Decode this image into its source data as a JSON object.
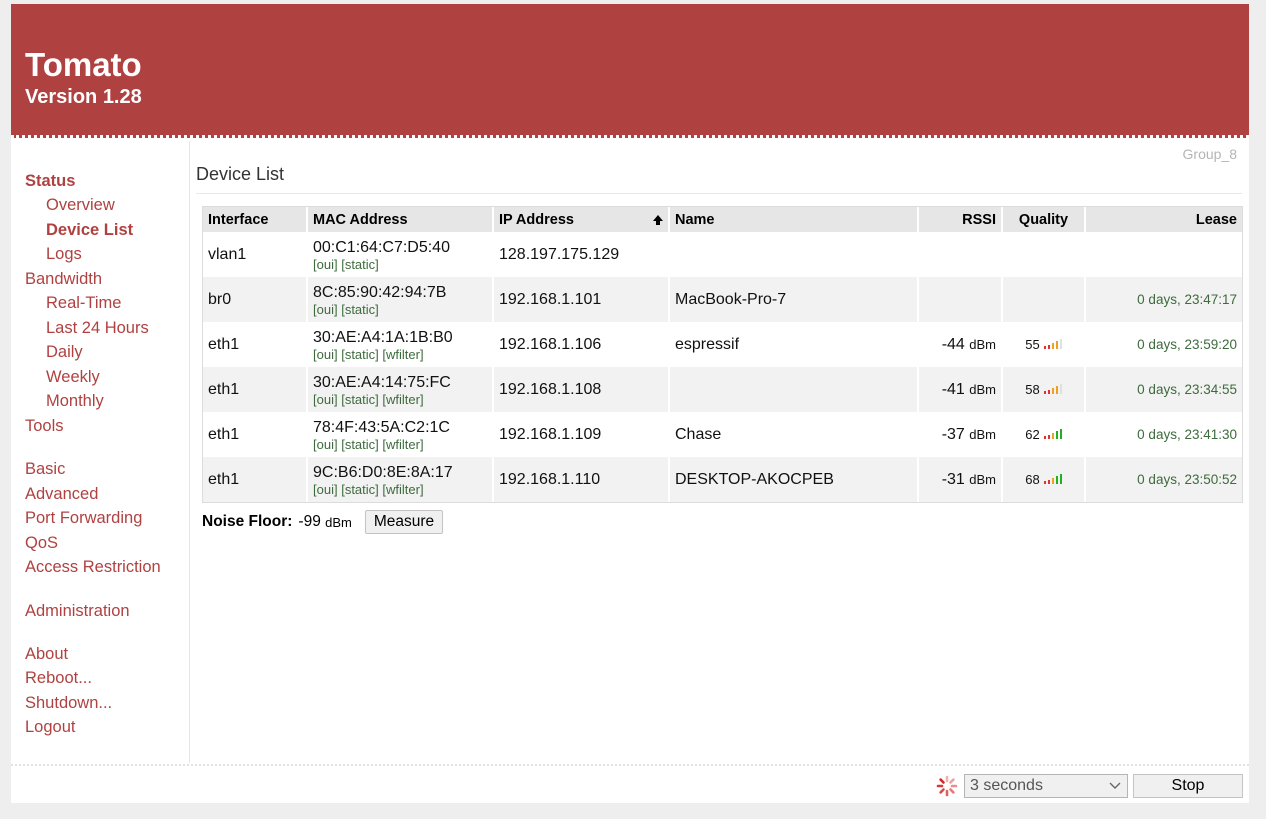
{
  "header": {
    "title": "Tomato",
    "version": "Version 1.28"
  },
  "group_label": "Group_8",
  "sidebar": [
    {
      "label": "Status",
      "type": "section-active"
    },
    {
      "label": "Overview",
      "type": "sub"
    },
    {
      "label": "Device List",
      "type": "sub-active"
    },
    {
      "label": "Logs",
      "type": "sub"
    },
    {
      "label": "Bandwidth",
      "type": "section"
    },
    {
      "label": "Real-Time",
      "type": "sub"
    },
    {
      "label": "Last 24 Hours",
      "type": "sub"
    },
    {
      "label": "Daily",
      "type": "sub"
    },
    {
      "label": "Weekly",
      "type": "sub"
    },
    {
      "label": "Monthly",
      "type": "sub"
    },
    {
      "label": "Tools",
      "type": "section"
    },
    {
      "label": "Basic",
      "type": "section"
    },
    {
      "label": "Advanced",
      "type": "section"
    },
    {
      "label": "Port Forwarding",
      "type": "section"
    },
    {
      "label": "QoS",
      "type": "section"
    },
    {
      "label": "Access Restriction",
      "type": "section"
    },
    {
      "label": "Administration",
      "type": "section"
    },
    {
      "label": "About",
      "type": "section"
    },
    {
      "label": "Reboot...",
      "type": "section"
    },
    {
      "label": "Shutdown...",
      "type": "section"
    },
    {
      "label": "Logout",
      "type": "section"
    }
  ],
  "page_title": "Device List",
  "table": {
    "headers": [
      "Interface",
      "MAC Address",
      "IP Address",
      "Name",
      "RSSI",
      "Quality",
      "Lease"
    ],
    "link_labels": {
      "oui": "[oui]",
      "static": "[static]",
      "wfilter": "[wfilter]"
    },
    "rssi_unit": "dBm",
    "rows": [
      {
        "interface": "vlan1",
        "mac": "00:C1:64:C7:D5:40",
        "links": [
          "oui",
          "static"
        ],
        "ip": "128.197.175.129",
        "name": "",
        "rssi": "",
        "quality": "",
        "bars": 0,
        "lease": ""
      },
      {
        "interface": "br0",
        "mac": "8C:85:90:42:94:7B",
        "links": [
          "oui",
          "static"
        ],
        "ip": "192.168.1.101",
        "name": "MacBook-Pro-7",
        "rssi": "",
        "quality": "",
        "bars": 0,
        "lease": "0 days, 23:47:17"
      },
      {
        "interface": "eth1",
        "mac": "30:AE:A4:1A:1B:B0",
        "links": [
          "oui",
          "static",
          "wfilter"
        ],
        "ip": "192.168.1.106",
        "name": "espressif",
        "rssi": "-44",
        "quality": "55",
        "bars": 4,
        "lease": "0 days, 23:59:20"
      },
      {
        "interface": "eth1",
        "mac": "30:AE:A4:14:75:FC",
        "links": [
          "oui",
          "static",
          "wfilter"
        ],
        "ip": "192.168.1.108",
        "name": "",
        "rssi": "-41",
        "quality": "58",
        "bars": 4,
        "lease": "0 days, 23:34:55"
      },
      {
        "interface": "eth1",
        "mac": "78:4F:43:5A:C2:1C",
        "links": [
          "oui",
          "static",
          "wfilter"
        ],
        "ip": "192.168.1.109",
        "name": "Chase",
        "rssi": "-37",
        "quality": "62",
        "bars": 5,
        "lease": "0 days, 23:41:30"
      },
      {
        "interface": "eth1",
        "mac": "9C:B6:D0:8E:8A:17",
        "links": [
          "oui",
          "static",
          "wfilter"
        ],
        "ip": "192.168.1.110",
        "name": "DESKTOP-AKOCPEB",
        "rssi": "-31",
        "quality": "68",
        "bars": 5,
        "lease": "0 days, 23:50:52"
      }
    ]
  },
  "noise_floor": {
    "label": "Noise Floor:",
    "value": "-99",
    "unit": "dBm",
    "button": "Measure"
  },
  "footer": {
    "interval": "3 seconds",
    "stop_button": "Stop"
  },
  "colors": {
    "brand": "#b04141",
    "link_green": "#3d6b3d",
    "bar_red": "#e03030",
    "bar_orange": "#f0a020",
    "bar_green": "#20b020"
  }
}
